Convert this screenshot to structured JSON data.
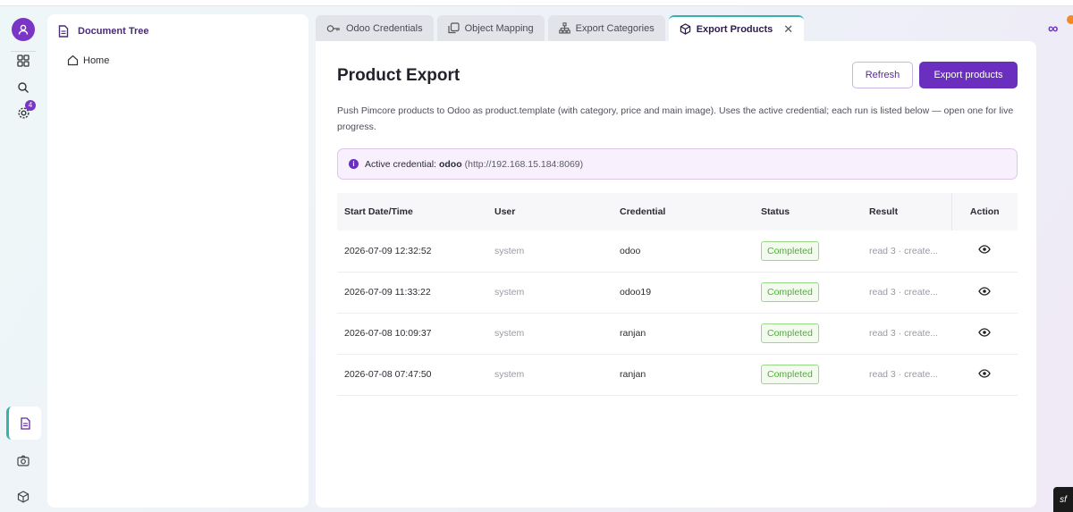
{
  "tree": {
    "title": "Document Tree",
    "home": "Home"
  },
  "rail": {
    "notification_count": "4"
  },
  "tabs": [
    {
      "label": "Odoo Credentials",
      "icon": "key-icon"
    },
    {
      "label": "Object Mapping",
      "icon": "copy-icon"
    },
    {
      "label": "Export Categories",
      "icon": "hierarchy-icon"
    },
    {
      "label": "Export Products",
      "icon": "cube-icon",
      "active": true
    }
  ],
  "main": {
    "title": "Product Export",
    "refresh_label": "Refresh",
    "export_label": "Export products",
    "description": "Push Pimcore products to Odoo as product.template (with category, price and main image). Uses the active credential; each run is listed below — open one for live progress.",
    "info": {
      "prefix": "Active credential:",
      "name": "odoo",
      "url": "(http://192.168.15.184:8069)"
    }
  },
  "table": {
    "headers": [
      "Start Date/Time",
      "User",
      "Credential",
      "Status",
      "Result",
      "Action"
    ],
    "rows": [
      {
        "date": "2026-07-09 12:32:52",
        "user": "system",
        "credential": "odoo",
        "status": "Completed",
        "result": "read 3 · create..."
      },
      {
        "date": "2026-07-09 11:33:22",
        "user": "system",
        "credential": "odoo19",
        "status": "Completed",
        "result": "read 3 · create..."
      },
      {
        "date": "2026-07-08 10:09:37",
        "user": "system",
        "credential": "ranjan",
        "status": "Completed",
        "result": "read 3 · create..."
      },
      {
        "date": "2026-07-08 07:47:50",
        "user": "system",
        "credential": "ranjan",
        "status": "Completed",
        "result": "read 3 · create..."
      }
    ]
  },
  "colors": {
    "accent": "#6a2fbf",
    "teal": "#37b3ad",
    "success": "#4fae3a"
  }
}
